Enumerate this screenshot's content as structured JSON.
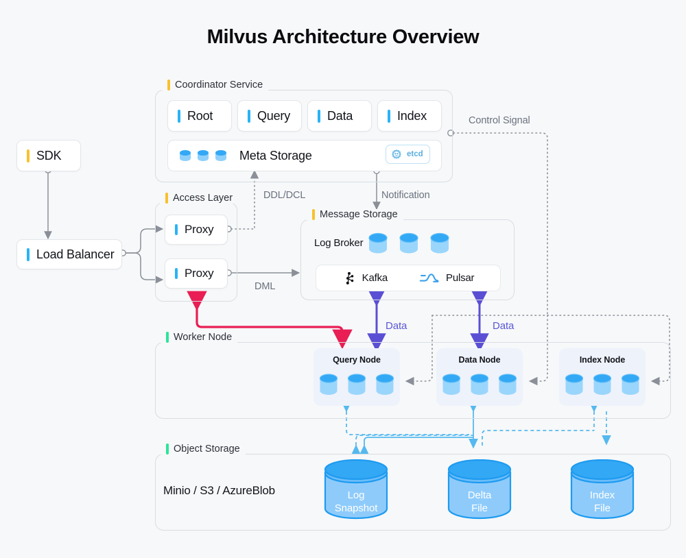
{
  "title": "Milvus Architecture Overview",
  "accents": {
    "yellow": "#f8c12c",
    "blue": "#2ab3f5",
    "green": "#2ce49a",
    "red": "#e8records",
    "arrow_red": "#e91e54",
    "arrow_purple": "#5a4fd4",
    "arrow_gray": "#8a8f98",
    "arrow_lightblue": "#55b9ef",
    "cylinder_blue": "#33a8f5",
    "cylinder_light": "#8fd0fb"
  },
  "groups": {
    "coordinator": {
      "label": "Coordinator Service",
      "bar_color": "#f8c12c"
    },
    "access": {
      "label": "Access Layer",
      "bar_color": "#f8c12c"
    },
    "message": {
      "label": "Message Storage",
      "bar_color": "#f8c12c"
    },
    "worker": {
      "label": "Worker Node",
      "bar_color": "#2ce49a"
    },
    "object": {
      "label": "Object Storage",
      "bar_color": "#2ce49a"
    }
  },
  "coordinator": {
    "cards": [
      {
        "label": "Root",
        "accent": "#2ab3f5"
      },
      {
        "label": "Query",
        "accent": "#2ab3f5"
      },
      {
        "label": "Data",
        "accent": "#2ab3f5"
      },
      {
        "label": "Index",
        "accent": "#2ab3f5"
      }
    ],
    "meta_storage": {
      "label": "Meta Storage",
      "badge": "etcd",
      "badge_icon": "etcd-gopher-icon"
    }
  },
  "left_column": {
    "sdk": {
      "label": "SDK",
      "accent": "#f8c12c"
    },
    "load_balancer": {
      "label": "Load Balancer",
      "accent": "#2ab3f5"
    }
  },
  "access_layer": {
    "proxies": [
      {
        "label": "Proxy",
        "accent": "#2ab3f5"
      },
      {
        "label": "Proxy",
        "accent": "#2ab3f5"
      }
    ]
  },
  "message_storage": {
    "log_broker_label": "Log Broker",
    "brokers": [
      {
        "name": "Kafka",
        "icon": "kafka-icon"
      },
      {
        "name": "Pulsar",
        "icon": "pulsar-icon"
      }
    ]
  },
  "worker_node": {
    "nodes": [
      {
        "title": "Query Node",
        "cylinders": 3
      },
      {
        "title": "Data Node",
        "cylinders": 3
      },
      {
        "title": "Index Node",
        "cylinders": 3
      }
    ]
  },
  "object_storage": {
    "providers": "Minio / S3 / AzureBlob",
    "files": [
      {
        "line1": "Log",
        "line2": "Snapshot"
      },
      {
        "line1": "Delta",
        "line2": "File"
      },
      {
        "line1": "Index",
        "line2": "File"
      }
    ]
  },
  "edge_labels": {
    "control_signal": "Control Signal",
    "ddl_dcl": "DDL/DCL",
    "notification": "Notification",
    "dml": "DML",
    "data_left": "Data",
    "data_right": "Data"
  }
}
